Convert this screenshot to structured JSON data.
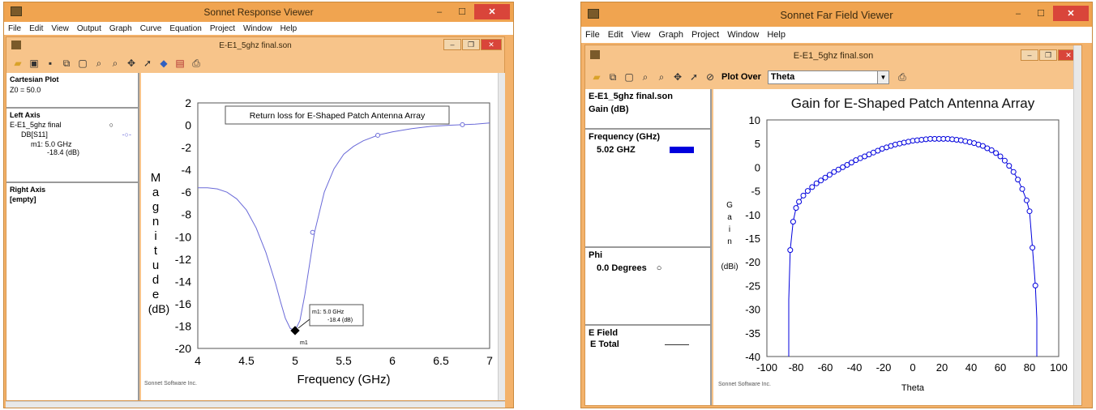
{
  "left_window": {
    "title": "Sonnet Response Viewer",
    "menu": [
      "File",
      "Edit",
      "View",
      "Output",
      "Graph",
      "Curve",
      "Equation",
      "Project",
      "Window",
      "Help"
    ],
    "child_title": "E-E1_5ghz final.son",
    "panel": {
      "plot_type": "Cartesian Plot",
      "z0": "Z0 = 50.0",
      "left_axis_header": "Left Axis",
      "file_name": "E-E1_5ghz final",
      "curve_name": "DB[S11]",
      "marker_label": "m1: 5.0 GHz",
      "marker_value": "-18.4  (dB)",
      "right_axis_header": "Right Axis",
      "right_axis_value": "[empty]"
    },
    "plot": {
      "legend_title": "Return loss for E-Shaped Patch Antenna Array",
      "ylabel_letters": [
        "M",
        "a",
        "g",
        "n",
        "i",
        "t",
        "u",
        "d",
        "e"
      ],
      "ylabel_unit": "(dB)",
      "xlabel": "Frequency (GHz)",
      "footer": "Sonnet Software Inc.",
      "marker_box_line1": "m1: 5.0 GHz",
      "marker_box_line2": "-18.4  (dB)",
      "marker_name": "m1"
    }
  },
  "right_window": {
    "title": "Sonnet Far Field Viewer",
    "menu": [
      "File",
      "Edit",
      "View",
      "Graph",
      "Project",
      "Window",
      "Help"
    ],
    "child_title": "E-E1_5ghz final.son",
    "plot_over_label": "Plot Over",
    "plot_over_value": "Theta",
    "panel": {
      "file_name": "E-E1_5ghz final.son",
      "quantity": "Gain (dB)",
      "freq_header": "Frequency (GHz)",
      "freq_value": "5.02 GHZ",
      "freq_color": "#0000dd",
      "phi_header": "Phi",
      "phi_value": "0.0 Degrees",
      "efield_header": "E Field",
      "efield_value": "E Total"
    },
    "plot": {
      "title": "Gain for E-Shaped Patch Antenna Array",
      "ylabel_letters": [
        "G",
        "a",
        "i",
        "n"
      ],
      "ylabel_unit": "(dBi)",
      "xlabel": "Theta",
      "footer": "Sonnet Software Inc."
    }
  },
  "chart_data": [
    {
      "type": "line",
      "title": "Return loss for E-Shaped Patch Antenna Array",
      "xlabel": "Frequency (GHz)",
      "ylabel": "Magnitude (dB)",
      "xlim": [
        4,
        7
      ],
      "ylim": [
        -20,
        2
      ],
      "xticks": [
        4,
        4.5,
        5,
        5.5,
        6,
        6.5,
        7
      ],
      "yticks": [
        2,
        0,
        -2,
        -4,
        -6,
        -8,
        -10,
        -12,
        -14,
        -16,
        -18,
        -20
      ],
      "grid": false,
      "series": [
        {
          "name": "DB[S11]",
          "color": "#6a6ad8",
          "x": [
            4.0,
            4.1,
            4.2,
            4.3,
            4.4,
            4.5,
            4.6,
            4.7,
            4.8,
            4.85,
            4.9,
            4.95,
            5.0,
            5.05,
            5.1,
            5.15,
            5.2,
            5.3,
            5.4,
            5.5,
            5.6,
            5.7,
            5.85,
            6.0,
            6.2,
            6.4,
            6.6,
            6.72,
            6.85,
            7.0
          ],
          "y": [
            -5.6,
            -5.6,
            -5.7,
            -6.0,
            -6.6,
            -7.6,
            -9.2,
            -11.4,
            -14.2,
            -15.8,
            -17.3,
            -18.2,
            -18.4,
            -17.5,
            -15.2,
            -12.4,
            -9.6,
            -6.0,
            -3.9,
            -2.6,
            -1.9,
            -1.4,
            -0.9,
            -0.6,
            -0.3,
            -0.1,
            0.0,
            0.05,
            0.1,
            0.2
          ]
        }
      ],
      "marker": {
        "name": "m1",
        "x": 5.0,
        "y": -18.4,
        "label": "m1: 5.0 GHz -18.4 (dB)"
      }
    },
    {
      "type": "line",
      "title": "Gain for E-Shaped Patch Antenna Array",
      "xlabel": "Theta",
      "ylabel": "Gain (dBi)",
      "xlim": [
        -100,
        100
      ],
      "ylim": [
        -40,
        10
      ],
      "xticks": [
        -100,
        -80,
        -60,
        -40,
        -20,
        0,
        20,
        40,
        60,
        80,
        100
      ],
      "yticks": [
        10,
        5,
        0,
        -5,
        -10,
        -15,
        -20,
        -25,
        -30,
        -35,
        -40
      ],
      "grid": false,
      "series": [
        {
          "name": "5.02 GHZ",
          "color": "#0000dd",
          "x": [
            -85,
            -85,
            -84,
            -82,
            -80,
            -78,
            -75,
            -72,
            -69,
            -66,
            -63,
            -60,
            -57,
            -54,
            -51,
            -48,
            -45,
            -42,
            -39,
            -36,
            -33,
            -30,
            -27,
            -24,
            -21,
            -18,
            -15,
            -12,
            -9,
            -6,
            -3,
            0,
            3,
            6,
            9,
            12,
            15,
            18,
            21,
            24,
            27,
            30,
            33,
            36,
            39,
            42,
            45,
            48,
            51,
            54,
            57,
            60,
            63,
            66,
            69,
            72,
            75,
            78,
            80,
            82,
            84,
            85,
            85
          ],
          "y": [
            -40,
            -28,
            -17.5,
            -11.5,
            -8.6,
            -7.3,
            -6.0,
            -5.0,
            -4.2,
            -3.4,
            -2.8,
            -2.2,
            -1.6,
            -1.0,
            -0.5,
            0.0,
            0.5,
            1.0,
            1.5,
            1.9,
            2.3,
            2.7,
            3.1,
            3.5,
            3.9,
            4.2,
            4.5,
            4.8,
            5.0,
            5.2,
            5.4,
            5.6,
            5.7,
            5.8,
            5.9,
            6.0,
            6.0,
            6.0,
            6.0,
            6.0,
            5.9,
            5.8,
            5.7,
            5.5,
            5.3,
            5.1,
            4.8,
            4.5,
            4.0,
            3.6,
            3.0,
            2.3,
            1.4,
            0.3,
            -1.0,
            -2.6,
            -4.6,
            -7.0,
            -9.3,
            -17,
            -25,
            -32,
            -40
          ]
        }
      ]
    }
  ]
}
